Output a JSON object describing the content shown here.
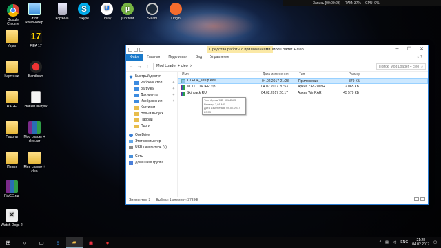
{
  "recbar": {
    "text": "Запись [00:00:23]",
    "stats": "RAM: 37%",
    "gpu": "CPU: 9%"
  },
  "desktop_icons": [
    {
      "label": "Google Chrome",
      "kind": "chrome"
    },
    {
      "label": "Этот компьютер",
      "kind": "pc"
    },
    {
      "label": "Корзина",
      "kind": "bin"
    },
    {
      "label": "Skype",
      "kind": "skype"
    },
    {
      "label": "Uplay",
      "kind": "uplay"
    },
    {
      "label": "µTorrent",
      "kind": "utor"
    },
    {
      "label": "Steam",
      "kind": "steam"
    },
    {
      "label": "Origin",
      "kind": "origin"
    },
    {
      "label": "Игры",
      "kind": "folder"
    },
    {
      "label": "FIFA 17",
      "kind": "game17"
    },
    {
      "label": "Картинки",
      "kind": "folder"
    },
    {
      "label": "Bandicam",
      "kind": "bandi"
    },
    {
      "label": "RAGE",
      "kind": "folder"
    },
    {
      "label": "Новый выпуск",
      "kind": "doc"
    },
    {
      "label": "Пароли",
      "kind": "folder"
    },
    {
      "label": "Mod Loader + cleo.rar",
      "kind": "rar"
    },
    {
      "label": "Проги",
      "kind": "folder"
    },
    {
      "label": "Mod Loader + cleo",
      "kind": "folder"
    },
    {
      "label": "RAGE.rar",
      "kind": "rar"
    },
    {
      "label": "Watch Dogs 2",
      "kind": "wd"
    }
  ],
  "window": {
    "context_tab": "Средства работы с приложениями",
    "title": "Mod Loader + cleo",
    "ribbon": {
      "file": "Файл",
      "home": "Главная",
      "share": "Поделиться",
      "view": "Вид",
      "manage": "Управление"
    },
    "address": {
      "parts": [
        "Mod Loader + cleo",
        ">"
      ],
      "search_placeholder": "Поиск: Mod Loader + cleo"
    },
    "nav": [
      {
        "label": "Быстрый доступ",
        "icon": "star"
      },
      {
        "label": "Рабочий стол",
        "icon": "blue"
      },
      {
        "label": "Загрузки",
        "icon": "blue"
      },
      {
        "label": "Документы",
        "icon": "blue"
      },
      {
        "label": "Изображения",
        "icon": "blue"
      },
      {
        "label": "Картинки",
        "icon": "fold"
      },
      {
        "label": "Новый выпуск",
        "icon": "fold"
      },
      {
        "label": "Пароли",
        "icon": "fold"
      },
      {
        "label": "Проги",
        "icon": "fold"
      },
      {
        "label": "OneDrive",
        "icon": "cloud"
      },
      {
        "label": "Этот компьютер",
        "icon": "pc"
      },
      {
        "label": "USB-накопитель (\\:)",
        "icon": "usb"
      },
      {
        "label": "Сеть",
        "icon": "net"
      },
      {
        "label": "Домашняя группа",
        "icon": "home"
      }
    ],
    "columns": {
      "name": "Имя",
      "date": "Дата изменения",
      "type": "Тип",
      "size": "Размер"
    },
    "files": [
      {
        "name": "CLEO4_setup.exe",
        "date": "04.02.2017 21:28",
        "type": "Приложение",
        "size": "379 КБ",
        "icon": "exe",
        "selected": true
      },
      {
        "name": "MOD LOADER.zip",
        "date": "04.02.2017 20:53",
        "type": "Архив ZIP - WinR...",
        "size": "2 065 КБ",
        "icon": "rar",
        "selected": false
      },
      {
        "name": "Skinpack RU",
        "date": "04.02.2017 20:17",
        "type": "Архив WinRAR",
        "size": "45 579 КБ",
        "icon": "rar",
        "selected": false
      }
    ],
    "tooltip": [
      "Тип: Архив ZIP - WinRAR",
      "Размер: 2,01 МБ",
      "Дата изменения: 04.02.2017 20:53"
    ],
    "status": {
      "count": "Элементов: 3",
      "selected": "Выбран 1 элемент: 378 КБ"
    }
  },
  "taskbar": {
    "lang": "ENG",
    "time": "21:28",
    "date": "04.02.2017"
  }
}
